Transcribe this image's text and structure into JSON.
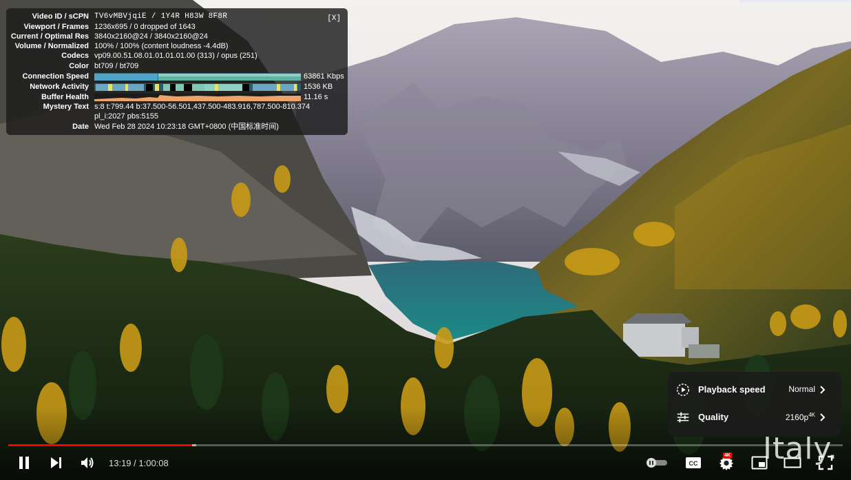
{
  "stats": {
    "close_label": "[X]",
    "rows": [
      {
        "label": "Video ID / sCPN",
        "value": "TV6vMBVjqiE / 1Y4R H83W 8F8R"
      },
      {
        "label": "Viewport / Frames",
        "value": "1236x695 / 0 dropped of 1643"
      },
      {
        "label": "Current / Optimal Res",
        "value": "3840x2160@24 / 3840x2160@24"
      },
      {
        "label": "Volume / Normalized",
        "value": "100% / 100% (content loudness -4.4dB)"
      },
      {
        "label": "Codecs",
        "value": "vp09.00.51.08.01.01.01.01.00 (313) / opus (251)"
      },
      {
        "label": "Color",
        "value": "bt709 / bt709"
      }
    ],
    "connection_speed": {
      "label": "Connection Speed",
      "value": "63861 Kbps"
    },
    "network_activity": {
      "label": "Network Activity",
      "value": "1536 KB"
    },
    "buffer_health": {
      "label": "Buffer Health",
      "value": "11.16 s"
    },
    "mystery_text": {
      "label": "Mystery Text",
      "line1": "s:8 t:799.44 b:37.500-56.501,437.500-483.916,787.500-810.374",
      "line2": "pl_i:2027 pbs:5155"
    },
    "date": {
      "label": "Date",
      "value": "Wed Feb 28 2024 10:23:18 GMT+0800 (中国标准时间)"
    }
  },
  "settings_menu": {
    "items": [
      {
        "label": "Playback speed",
        "value": "Normal",
        "icon": "playback-speed-icon"
      },
      {
        "label": "Quality",
        "value": "2160p",
        "value_sup": "4K",
        "icon": "quality-sliders-icon"
      }
    ]
  },
  "progress": {
    "played_fraction": 0.22,
    "loaded_fraction": 0.225
  },
  "controls": {
    "time": "13:19 / 1:00:08",
    "settings_badge": "4K",
    "icons": [
      "pause-icon",
      "next-icon",
      "volume-icon",
      "autoplay-toggle-icon",
      "captions-icon",
      "settings-gear-icon",
      "miniplayer-icon",
      "theater-icon",
      "fullscreen-icon"
    ]
  },
  "watermark": "Italy.",
  "colors": {
    "progress_played": "#ff0000",
    "settings_badge": "#ff0000",
    "connection_graph": "#4fa3c6",
    "buffer_graph": "#e8a46a"
  }
}
